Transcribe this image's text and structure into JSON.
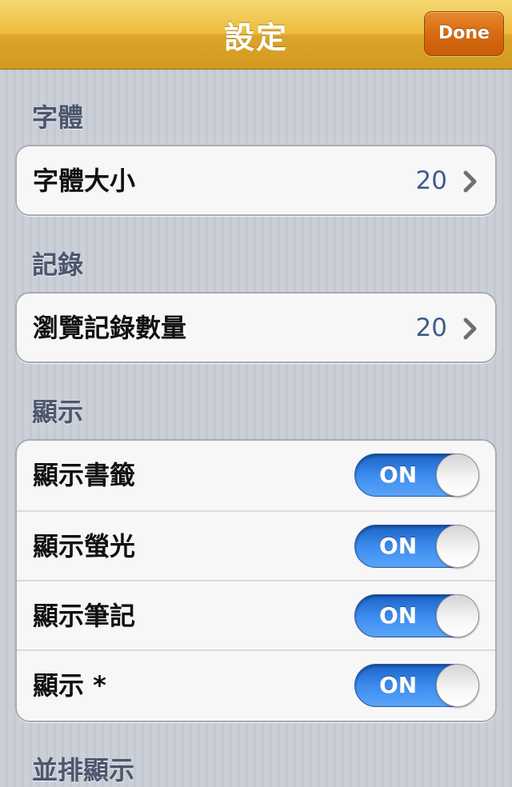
{
  "navbar": {
    "title": "設定",
    "done_label": "Done"
  },
  "sections": [
    {
      "header": "字體",
      "rows": [
        {
          "label": "字體大小",
          "value": "20",
          "type": "disclosure"
        }
      ]
    },
    {
      "header": "記錄",
      "rows": [
        {
          "label": "瀏覽記錄數量",
          "value": "20",
          "type": "disclosure"
        }
      ]
    },
    {
      "header": "顯示",
      "rows": [
        {
          "label": "顯示書籤",
          "switch": "ON",
          "type": "toggle"
        },
        {
          "label": "顯示螢光",
          "switch": "ON",
          "type": "toggle"
        },
        {
          "label": "顯示筆記",
          "switch": "ON",
          "type": "toggle"
        },
        {
          "label": "顯示 *",
          "switch": "ON",
          "type": "toggle"
        }
      ]
    },
    {
      "header": "並排顯示",
      "rows": []
    }
  ],
  "colors": {
    "navbar_gold": "#ebbd3c",
    "done_orange": "#d76a12",
    "switch_blue": "#3f8ef0",
    "value_blue": "#3e5d8c",
    "section_header": "#4c566c"
  },
  "icons": {
    "disclosure": "chevron-right-icon"
  }
}
